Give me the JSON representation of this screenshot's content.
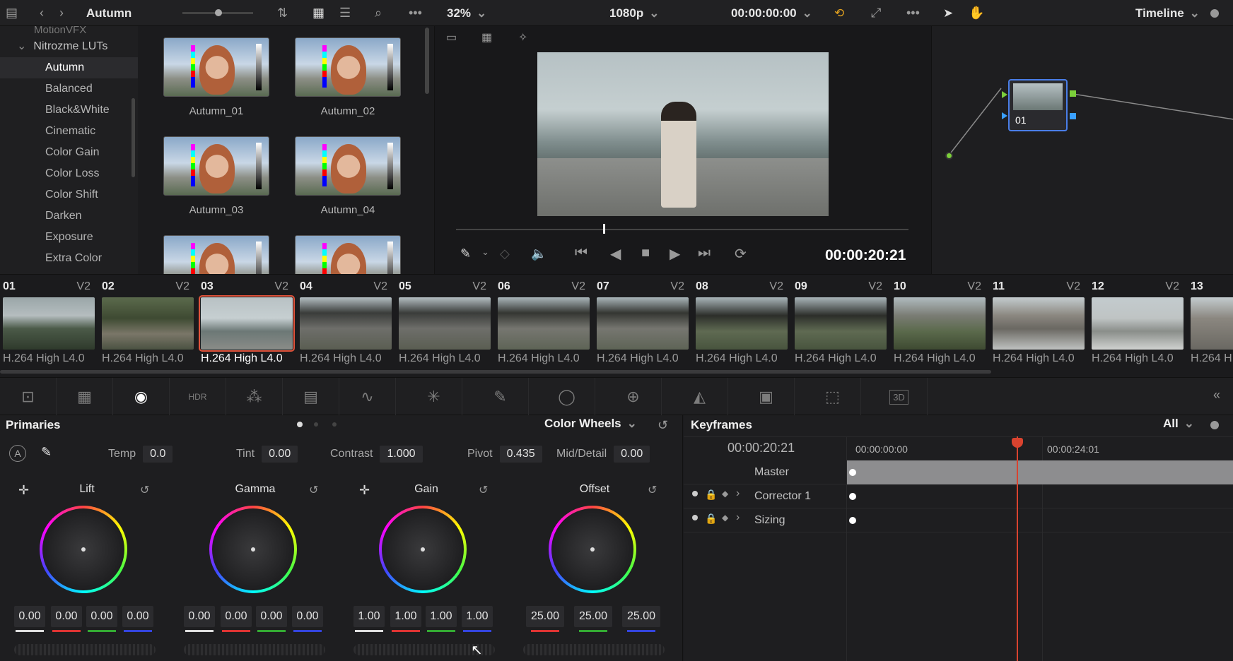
{
  "topbar": {
    "bin_name": "Autumn",
    "zoom": "32%",
    "resolution": "1080p",
    "timecode": "00:00:00:00",
    "mode": "Timeline"
  },
  "lut_browser": {
    "cut_off_item": "MotionVFX",
    "folder": "Nitrozme LUTs",
    "items": [
      "Autumn",
      "Balanced",
      "Black&White",
      "Cinematic",
      "Color Gain",
      "Color Loss",
      "Color Shift",
      "Darken",
      "Exposure",
      "Extra Color"
    ],
    "selected": "Autumn"
  },
  "gallery": {
    "cards": [
      "Autumn_01",
      "Autumn_02",
      "Autumn_03",
      "Autumn_04"
    ]
  },
  "viewer": {
    "timecode": "00:00:20:21"
  },
  "node": {
    "label": "01"
  },
  "clips": [
    {
      "num": "01",
      "track": "V2",
      "codec": "H.264 High L4.0"
    },
    {
      "num": "02",
      "track": "V2",
      "codec": "H.264 High L4.0"
    },
    {
      "num": "03",
      "track": "V2",
      "codec": "H.264 High L4.0"
    },
    {
      "num": "04",
      "track": "V2",
      "codec": "H.264 High L4.0"
    },
    {
      "num": "05",
      "track": "V2",
      "codec": "H.264 High L4.0"
    },
    {
      "num": "06",
      "track": "V2",
      "codec": "H.264 High L4.0"
    },
    {
      "num": "07",
      "track": "V2",
      "codec": "H.264 High L4.0"
    },
    {
      "num": "08",
      "track": "V2",
      "codec": "H.264 High L4.0"
    },
    {
      "num": "09",
      "track": "V2",
      "codec": "H.264 High L4.0"
    },
    {
      "num": "10",
      "track": "V2",
      "codec": "H.264 High L4.0"
    },
    {
      "num": "11",
      "track": "V2",
      "codec": "H.264 High L4.0"
    },
    {
      "num": "12",
      "track": "V2",
      "codec": "H.264 High L4.0"
    },
    {
      "num": "13",
      "track": "",
      "codec": "H.264 H"
    }
  ],
  "selected_clip": "03",
  "primaries": {
    "title": "Primaries",
    "mode": "Color Wheels",
    "temp_label": "Temp",
    "temp": "0.0",
    "tint_label": "Tint",
    "tint": "0.00",
    "contrast_label": "Contrast",
    "contrast": "1.000",
    "pivot_label": "Pivot",
    "pivot": "0.435",
    "middetail_label": "Mid/Detail",
    "middetail": "0.00",
    "wheels": [
      {
        "name": "Lift",
        "values": [
          "0.00",
          "0.00",
          "0.00",
          "0.00"
        ]
      },
      {
        "name": "Gamma",
        "values": [
          "0.00",
          "0.00",
          "0.00",
          "0.00"
        ]
      },
      {
        "name": "Gain",
        "values": [
          "1.00",
          "1.00",
          "1.00",
          "1.00"
        ]
      },
      {
        "name": "Offset",
        "values": [
          "25.00",
          "25.00",
          "25.00"
        ]
      }
    ],
    "auto_label": "A"
  },
  "keyframes": {
    "title": "Keyframes",
    "filter": "All",
    "current_tc": "00:00:20:21",
    "ruler_start": "00:00:00:00",
    "ruler_mark": "00:00:24:01",
    "rows": [
      "Master",
      "Corrector 1",
      "Sizing"
    ]
  },
  "tools": {
    "three_d": "3D",
    "hdr": "HDR"
  }
}
